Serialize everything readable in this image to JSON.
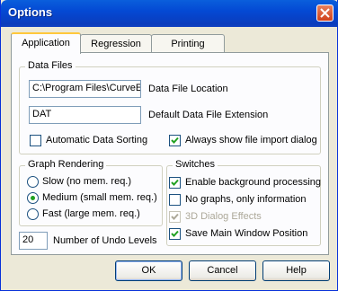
{
  "window": {
    "title": "Options"
  },
  "tabs": [
    {
      "label": "Application"
    },
    {
      "label": "Regression"
    },
    {
      "label": "Printing"
    }
  ],
  "data_files": {
    "group_label": "Data Files",
    "file_location_value": "C:\\Program Files\\CurveE",
    "file_location_label": "Data File Location",
    "extension_value": "DAT",
    "extension_label": "Default Data File Extension",
    "auto_sort_label": "Automatic Data Sorting",
    "auto_sort_checked": false,
    "import_dialog_label": "Always show file import dialog",
    "import_dialog_checked": true
  },
  "graph_rendering": {
    "group_label": "Graph Rendering",
    "options": [
      {
        "label": "Slow (no mem. req.)",
        "selected": false
      },
      {
        "label": "Medium (small mem. req.)",
        "selected": true
      },
      {
        "label": "Fast (large mem. req.)",
        "selected": false
      }
    ]
  },
  "switches": {
    "group_label": "Switches",
    "items": [
      {
        "label": "Enable background processing",
        "checked": true,
        "enabled": true
      },
      {
        "label": "No graphs, only information",
        "checked": false,
        "enabled": true
      },
      {
        "label": "3D Dialog Effects",
        "checked": true,
        "enabled": false
      },
      {
        "label": "Save Main Window Position",
        "checked": true,
        "enabled": true
      }
    ]
  },
  "undo": {
    "value": "20",
    "label": "Number of Undo Levels"
  },
  "buttons": {
    "ok": "OK",
    "cancel": "Cancel",
    "help": "Help"
  }
}
